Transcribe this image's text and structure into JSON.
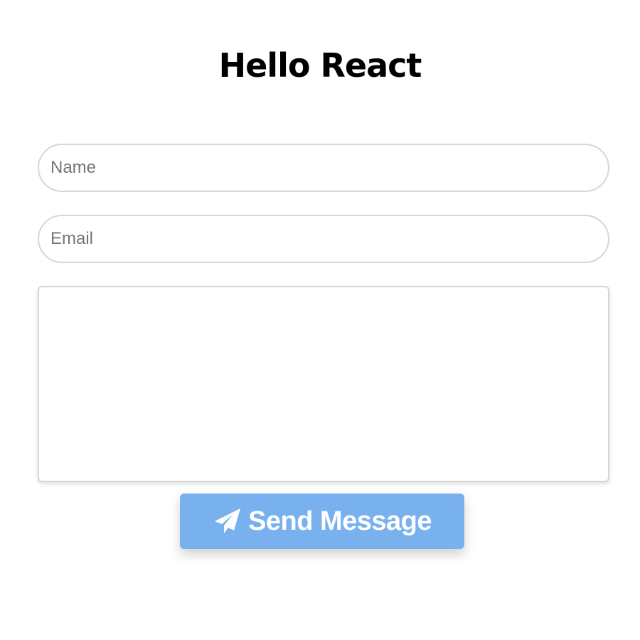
{
  "header": {
    "title": "Hello React"
  },
  "form": {
    "name": {
      "placeholder": "Name",
      "value": ""
    },
    "email": {
      "placeholder": "Email",
      "value": ""
    },
    "message": {
      "placeholder": "",
      "value": ""
    },
    "submit": {
      "label": "Send Message",
      "icon": "paper-plane-icon"
    }
  },
  "colors": {
    "button_background": "#78b1ee",
    "button_text": "#ffffff",
    "input_border": "#d6d6d6",
    "placeholder_text": "#757575"
  }
}
